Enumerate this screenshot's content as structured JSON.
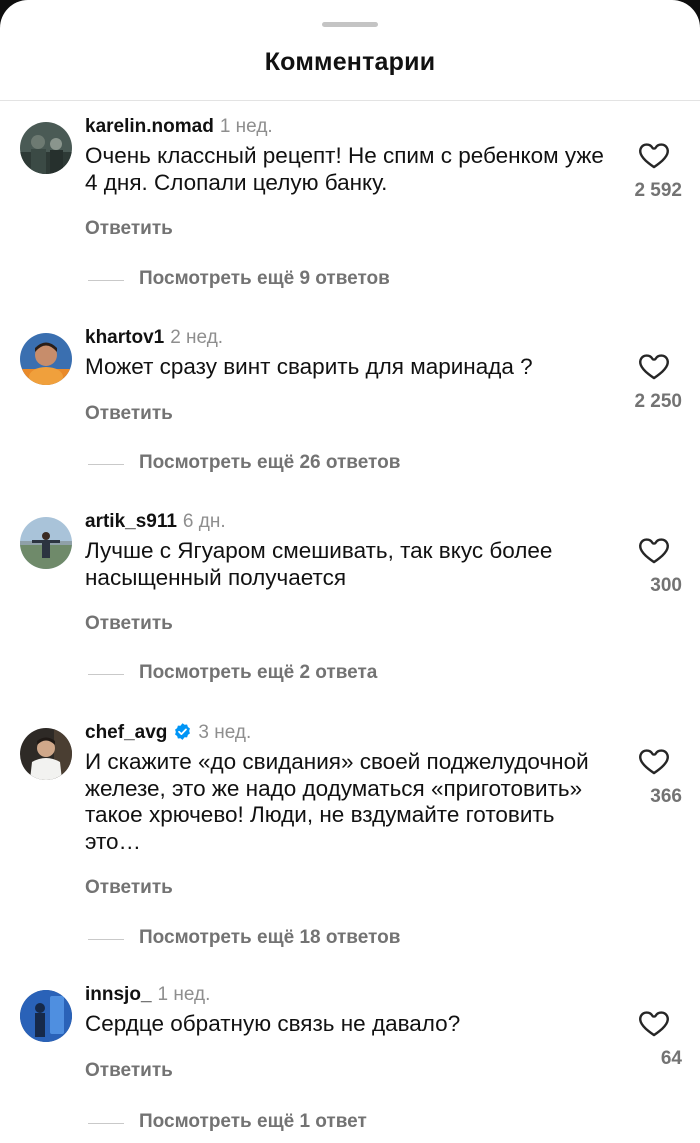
{
  "sheet": {
    "title": "Комментарии"
  },
  "comments": [
    {
      "username": "karelin.nomad",
      "time": "1 нед.",
      "text": "Очень классный рецепт! Не спим с ребенком уже 4 дня. Слопали целую банку.",
      "reply_label": "Ответить",
      "likes": "2 592",
      "view_replies": "Посмотреть ещё 9 ответов",
      "avatar_icon": "avatar-photo-icon",
      "verified": false
    },
    {
      "username": "khartov1",
      "time": "2 нед.",
      "text": "Может сразу винт сварить для маринада ?",
      "reply_label": "Ответить",
      "likes": "2 250",
      "view_replies": "Посмотреть ещё 26 ответов",
      "avatar_icon": "avatar-photo-icon",
      "verified": false
    },
    {
      "username": "artik_s911",
      "time": "6 дн.",
      "text": "Лучше с Ягуаром смешивать, так вкус более насыщенный получается",
      "reply_label": "Ответить",
      "likes": "300",
      "view_replies": "Посмотреть ещё 2 ответа",
      "avatar_icon": "avatar-photo-icon",
      "verified": false
    },
    {
      "username": "chef_avg",
      "time": "3 нед.",
      "text": "И скажите «до свидания» своей поджелудочной железе, это же надо додуматься «приготовить» такое хрючево! Люди, не вздумайте готовить это…",
      "reply_label": "Ответить",
      "likes": "366",
      "view_replies": "Посмотреть ещё 18 ответов",
      "avatar_icon": "avatar-photo-icon",
      "verified": true
    },
    {
      "username": "innsjo_",
      "time": "1 нед.",
      "text": "Сердце обратную связь не давало?",
      "reply_label": "Ответить",
      "likes": "64",
      "view_replies": "Посмотреть ещё 1 ответ",
      "avatar_icon": "avatar-photo-icon",
      "verified": false
    }
  ],
  "icons": {
    "like": "heart-outline-icon",
    "verified": "verified-badge-icon"
  },
  "colors": {
    "verified_blue": "#0095f6",
    "secondary_text": "#737373",
    "primary_text": "#111111"
  }
}
